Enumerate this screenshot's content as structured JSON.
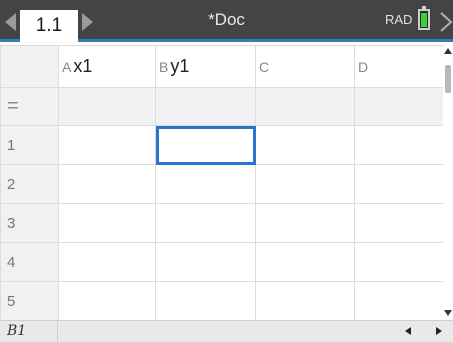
{
  "titlebar": {
    "tab_label": "1.1",
    "document_title": "*Doc",
    "angle_mode": "RAD",
    "battery_color": "#3ccf3c",
    "accent_color": "#2f7fb4"
  },
  "spreadsheet": {
    "columns": [
      {
        "letter": "A",
        "name": "x1"
      },
      {
        "letter": "B",
        "name": "y1"
      },
      {
        "letter": "C",
        "name": ""
      },
      {
        "letter": "D",
        "name": ""
      }
    ],
    "formula_row_symbol": "=",
    "row_numbers": [
      "1",
      "2",
      "3",
      "4",
      "5"
    ],
    "selected_cell": "B1"
  },
  "statusbar": {
    "cell_reference": "B1"
  },
  "icons": {
    "prev_page": "triangle-left-icon",
    "next_page": "triangle-right-icon",
    "battery": "battery-icon",
    "expand": "chevron-right-icon"
  }
}
